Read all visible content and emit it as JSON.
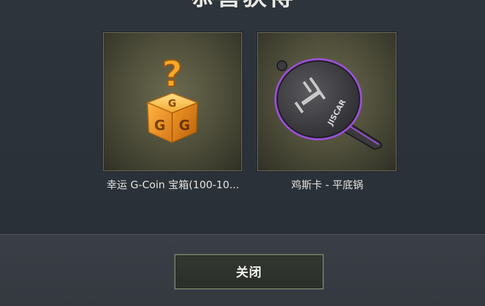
{
  "header": {
    "title": "恭喜获得"
  },
  "rewards": [
    {
      "name": "幸运 G-Coin 宝箱(100-10...",
      "icon": "mystery-crate-icon"
    },
    {
      "name": "鸡斯卡 - 平底锅",
      "icon": "frying-pan-icon"
    }
  ],
  "crate": {
    "question_mark": "?",
    "letter": "G"
  },
  "pan": {
    "logo_text": "JISCAR"
  },
  "footer": {
    "close_label": "关闭"
  },
  "colors": {
    "accent_gold": "#f0a020",
    "pan_rim": "#9a4fd6",
    "background": "#2b3138"
  }
}
